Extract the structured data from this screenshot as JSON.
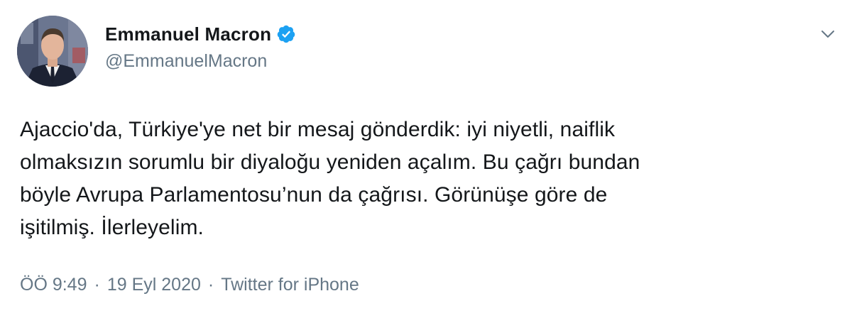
{
  "author": {
    "display_name": "Emmanuel Macron",
    "handle": "@EmmanuelMacron",
    "verified": true,
    "avatar_icon": "profile-photo"
  },
  "tweet": {
    "text": "Ajaccio'da, Türkiye'ye net bir mesaj gönderdik: iyi niyetli, naiflik\nolmaksızın sorumlu bir diyaloğu yeniden açalım. Bu çağrı bundan\nböyle Avrupa Parlamentosu’nun da çağrısı. Görünüşe göre de\nişitilmiş. İlerleyelim."
  },
  "meta": {
    "time": "ÖÖ 9:49",
    "separator": "·",
    "date": "19 Eyl 2020",
    "source": "Twitter for iPhone"
  },
  "icons": {
    "verified": "verified-badge-icon",
    "menu": "chevron-down-icon"
  },
  "colors": {
    "verified_blue": "#1da1f2",
    "secondary_text": "#657786",
    "primary_text": "#14171a"
  }
}
